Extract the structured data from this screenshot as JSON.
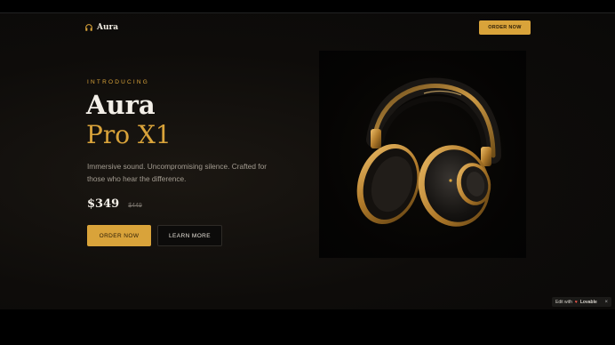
{
  "brand": {
    "name": "Aura",
    "icon": "headphones-icon"
  },
  "nav": {
    "order_label": "ORDER NOW"
  },
  "hero": {
    "eyebrow": "INTRODUCING",
    "title_line1": "Aura",
    "title_line2": "Pro X1",
    "description": "Immersive sound. Uncompromising silence. Crafted for those who hear the difference.",
    "price": "$349",
    "old_price": "$449",
    "primary_cta": "ORDER NOW",
    "secondary_cta": "LEARN MORE"
  },
  "product_image": {
    "icon": "headphones-image"
  },
  "editor_badge": {
    "prefix": "Edit with",
    "brand": "Lovable",
    "close": "×"
  },
  "colors": {
    "accent": "#d9a33a",
    "background": "#0e0c0a",
    "text": "#f3efe8"
  }
}
